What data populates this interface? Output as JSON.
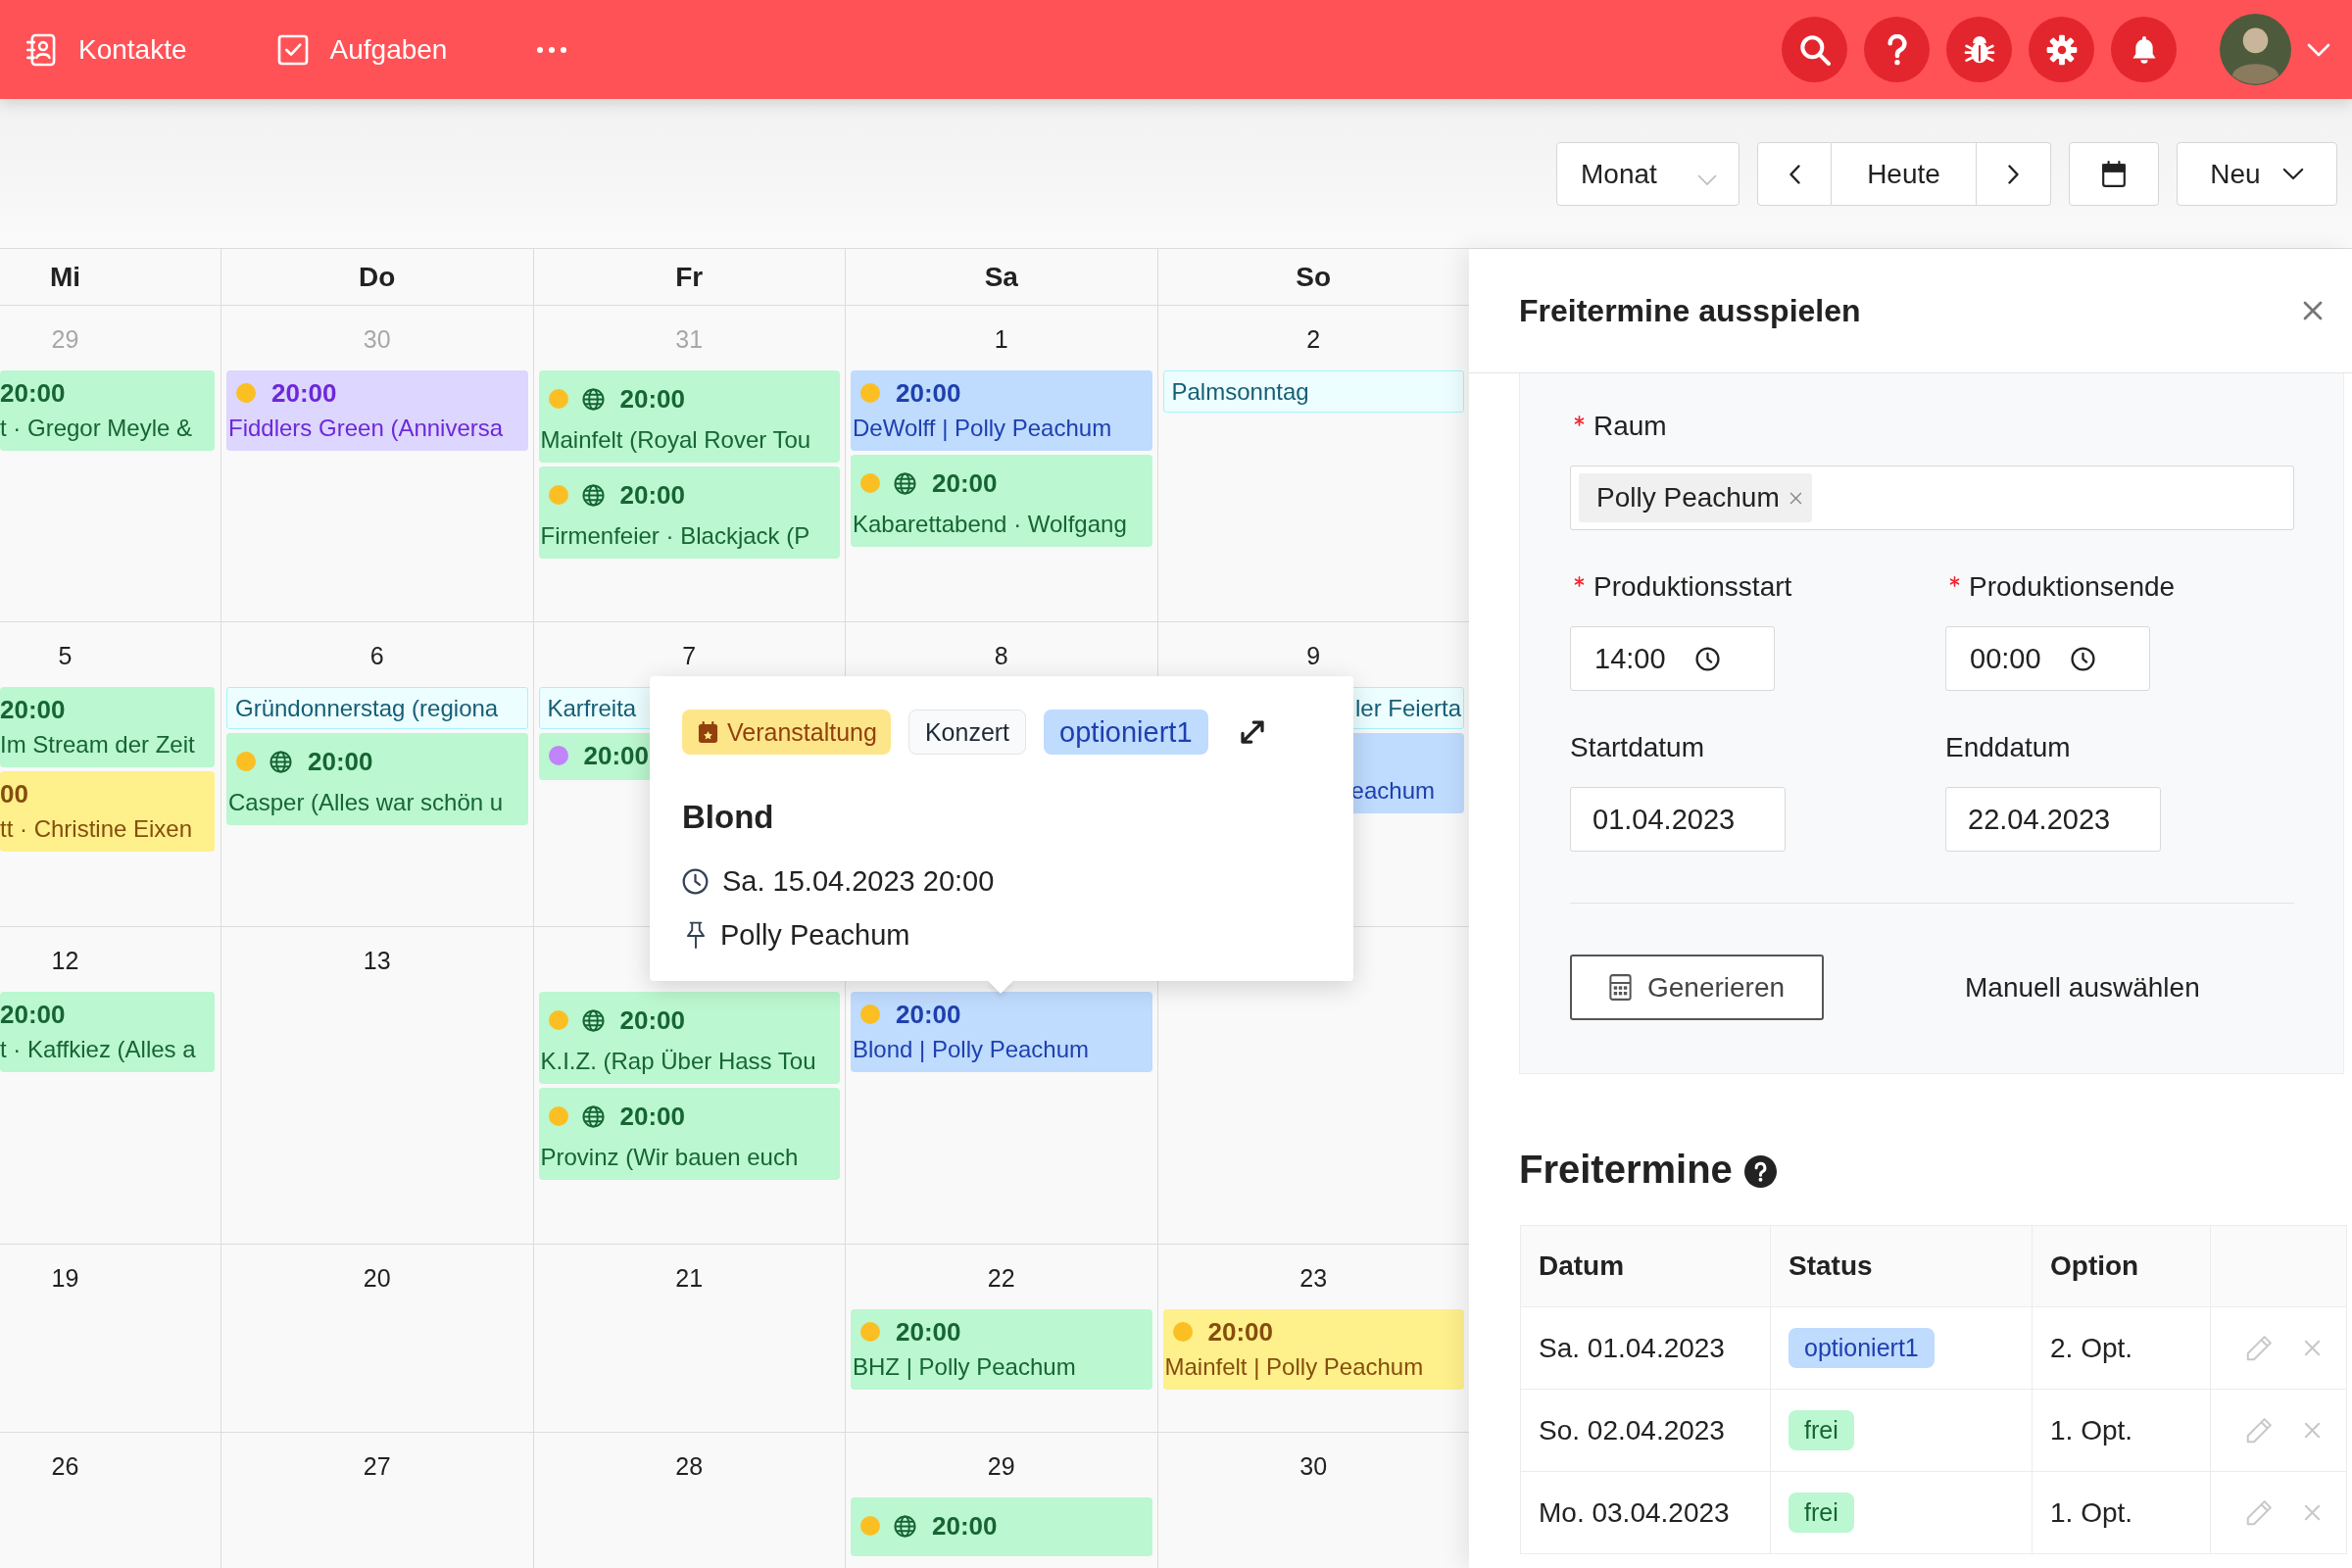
{
  "topbar": {
    "nav": [
      "Kontakte",
      "Aufgaben"
    ]
  },
  "toolbar": {
    "view": "Monat",
    "today": "Heute",
    "new": "Neu"
  },
  "calendar": {
    "weekdays": [
      "Mi",
      "Do",
      "Fr",
      "Sa",
      "So"
    ],
    "weeks": [
      {
        "days": [
          {
            "number": "29",
            "outside": true,
            "events": [
              {
                "kind": "event",
                "color": "#bbf7d0",
                "time": "20:00",
                "title": "t · Gregor Meyle &"
              }
            ]
          },
          {
            "number": "30",
            "outside": true,
            "events": [
              {
                "kind": "event",
                "color": "#ddd6fe",
                "dot": {
                  "color": "#fbbf24"
                },
                "online": false,
                "time": "20:00",
                "title": "Fiddlers Green (Anniversa"
              }
            ]
          },
          {
            "number": "31",
            "outside": true,
            "events": [
              {
                "kind": "event",
                "color": "#bbf7d0",
                "dot": {
                  "color": "#fbbf24"
                },
                "online": true,
                "time": "20:00",
                "title": "Mainfelt (Royal Rover Tou"
              },
              {
                "kind": "event",
                "color": "#bbf7d0",
                "dot": {
                  "color": "#fbbf24"
                },
                "online": true,
                "time": "20:00",
                "title": "Firmenfeier · Blackjack (P"
              }
            ]
          },
          {
            "number": "1",
            "outside": false,
            "events": [
              {
                "kind": "event",
                "color": "#bfdbfe",
                "dot": {
                  "color": "#fbbf24"
                },
                "online": false,
                "time": "20:00",
                "title": "DeWolff | Polly Peachum"
              },
              {
                "kind": "event",
                "color": "#bbf7d0",
                "dot": {
                  "color": "#fbbf24"
                },
                "online": true,
                "time": "20:00",
                "title": "Kabarettabend · Wolfgang"
              }
            ]
          },
          {
            "number": "2",
            "outside": false,
            "events": [
              {
                "kind": "holiday",
                "title": "Palmsonntag"
              }
            ]
          }
        ]
      },
      {
        "days": [
          {
            "number": "5",
            "outside": false,
            "events": [
              {
                "kind": "event",
                "color": "#bbf7d0",
                "time": "20:00",
                "title": "Im Stream der Zeit"
              },
              {
                "kind": "event",
                "color": "#fef08a",
                "time": "00",
                "title": "tt · Christine Eixen"
              }
            ]
          },
          {
            "number": "6",
            "outside": false,
            "events": [
              {
                "kind": "holiday",
                "title": "Gründonnerstag (regiona"
              },
              {
                "kind": "event",
                "color": "#bbf7d0",
                "dot": {
                  "color": "#fbbf24"
                },
                "online": true,
                "time": "20:00",
                "title": "Casper (Alles war schön u"
              }
            ]
          },
          {
            "number": "7",
            "outside": false,
            "events": [
              {
                "kind": "holiday",
                "title": "Karfreita"
              },
              {
                "kind": "event",
                "color": "#bbf7d0",
                "dot": {
                  "color": "#c084fc"
                },
                "online": false,
                "time": "20:00"
              }
            ]
          },
          {
            "number": "8",
            "outside": false
          },
          {
            "number": "9",
            "outside": false,
            "events": [
              {
                "kind": "holiday",
                "title": "ler Feierta"
              },
              {
                "kind": "event",
                "color": "#bfdbfe",
                "title": "eachum"
              }
            ]
          }
        ]
      },
      {
        "days": [
          {
            "number": "12",
            "outside": false,
            "events": [
              {
                "kind": "event",
                "color": "#bbf7d0",
                "time": "20:00",
                "title": "t · Kaffkiez (Alles a"
              }
            ]
          },
          {
            "number": "13",
            "outside": false
          },
          {
            "events": [
              {
                "kind": "event",
                "color": "#bbf7d0",
                "dot": {
                  "color": "#fbbf24"
                },
                "online": true,
                "time": "20:00",
                "title": "K.I.Z. (Rap Über Hass Tou"
              },
              {
                "kind": "event",
                "color": "#bbf7d0",
                "dot": {
                  "color": "#fbbf24"
                },
                "online": true,
                "time": "20:00",
                "title": "Provinz (Wir bauen euch"
              }
            ]
          },
          {
            "events": [
              {
                "kind": "event",
                "color": "#bfdbfe",
                "dot": {
                  "color": "#fbbf24"
                },
                "online": false,
                "time": "20:00",
                "title": "Blond | Polly Peachum"
              }
            ]
          }
        ]
      },
      {
        "days": [
          {
            "number": "19",
            "outside": false
          },
          {
            "number": "20",
            "outside": false
          },
          {
            "number": "21",
            "outside": false
          },
          {
            "number": "22",
            "outside": false,
            "events": [
              {
                "kind": "event",
                "color": "#bbf7d0",
                "dot": {
                  "color": "#fbbf24"
                },
                "online": false,
                "time": "20:00",
                "title": "BHZ | Polly Peachum"
              }
            ]
          },
          {
            "number": "23",
            "outside": false,
            "events": [
              {
                "kind": "event",
                "color": "#fef08a",
                "dot": {
                  "color": "#fbbf24"
                },
                "online": false,
                "time": "20:00",
                "title": "Mainfelt | Polly Peachum"
              }
            ]
          }
        ]
      },
      {
        "days": [
          {
            "number": "26",
            "outside": false
          },
          {
            "number": "27",
            "outside": false
          },
          {
            "number": "28",
            "outside": false
          },
          {
            "number": "29",
            "outside": false,
            "events": [
              {
                "kind": "event",
                "color": "#bbf7d0",
                "dot": {
                  "color": "#fbbf24"
                },
                "online": true,
                "time": "20:00"
              }
            ]
          },
          {
            "number": "30",
            "outside": false
          }
        ]
      }
    ]
  },
  "popover": {
    "tags": [
      {
        "kind": "type",
        "label": "Veranstaltung"
      },
      {
        "kind": "category",
        "label": "Konzert"
      },
      {
        "kind": "status",
        "label": "optioniert1"
      }
    ],
    "title": "Blond",
    "datetime": "Sa. 15.04.2023 20:00",
    "location": "Polly Peachum"
  },
  "panel": {
    "title": "Freitermine ausspielen",
    "room": {
      "label": "Raum",
      "required": true,
      "chips": [
        "Polly Peachum"
      ]
    },
    "fields": [
      {
        "kind": "time",
        "label": "Produktionsstart",
        "required": true,
        "value": "14:00"
      },
      {
        "kind": "time",
        "label": "Produktionsende",
        "required": true,
        "value": "00:00"
      },
      {
        "kind": "date",
        "label": "Startdatum",
        "required": false,
        "value": "01.04.2023"
      },
      {
        "kind": "date",
        "label": "Enddatum",
        "required": false,
        "value": "22.04.2023"
      }
    ],
    "generate": "Generieren",
    "manual": "Manuell auswählen",
    "results": {
      "title": "Freitermine",
      "columns": [
        "Datum",
        "Status",
        "Option"
      ],
      "rows": [
        {
          "date": "Sa. 01.04.2023",
          "status": {
            "kind": "optioned",
            "label": "optioniert1"
          },
          "option": "2. Opt."
        },
        {
          "date": "So. 02.04.2023",
          "status": {
            "kind": "free",
            "label": "frei"
          },
          "option": "1. Opt."
        },
        {
          "date": "Mo. 03.04.2023",
          "status": {
            "kind": "free",
            "label": "frei"
          },
          "option": "1. Opt."
        }
      ]
    }
  }
}
